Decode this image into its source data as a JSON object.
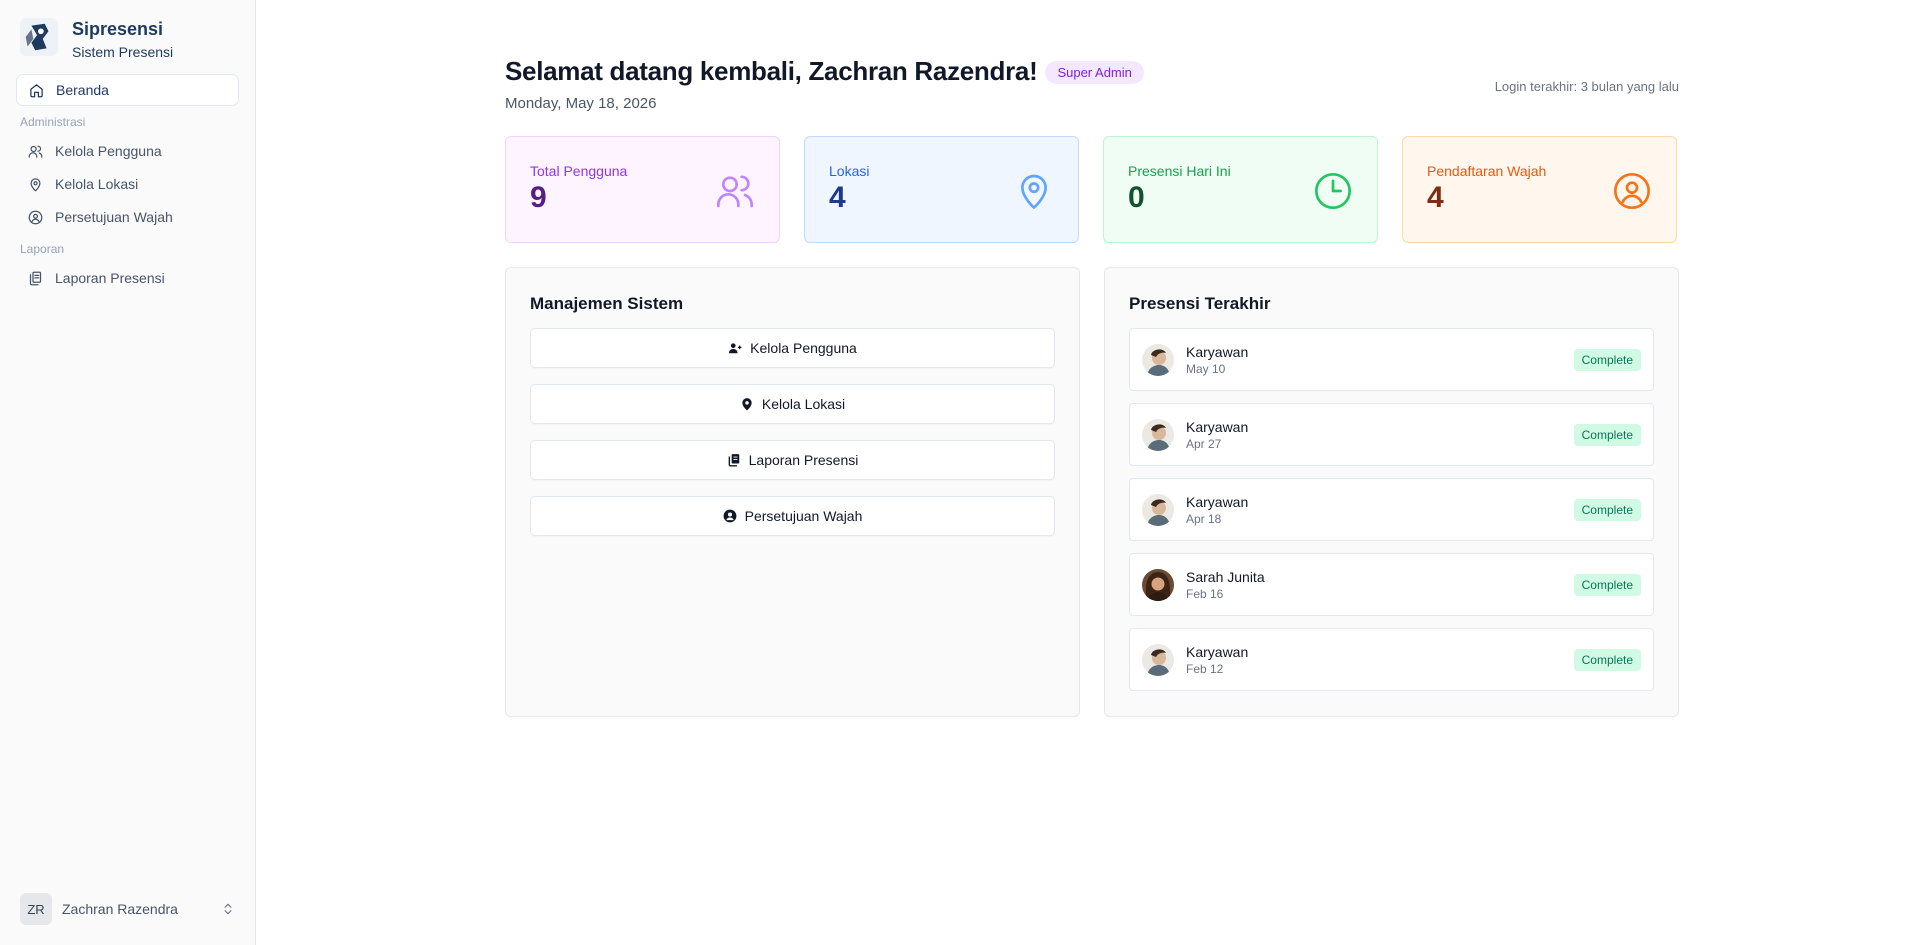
{
  "brand": {
    "title": "Sipresensi",
    "subtitle": "Sistem Presensi"
  },
  "sidebar": {
    "home": {
      "label": "Beranda",
      "icon": "home-icon"
    },
    "groups": [
      {
        "label": "Administrasi",
        "items": [
          {
            "label": "Kelola Pengguna",
            "icon": "users-icon"
          },
          {
            "label": "Kelola Lokasi",
            "icon": "map-pin-icon"
          },
          {
            "label": "Persetujuan Wajah",
            "icon": "user-circle-icon"
          }
        ]
      },
      {
        "label": "Laporan",
        "items": [
          {
            "label": "Laporan Presensi",
            "icon": "files-icon"
          }
        ]
      }
    ],
    "user": {
      "initials": "ZR",
      "name": "Zachran Razendra"
    }
  },
  "header": {
    "welcome": "Selamat datang kembali, Zachran Razendra!",
    "role_badge": "Super Admin",
    "date": "Monday, May 18, 2026",
    "last_login": "Login terakhir: 3 bulan yang lalu"
  },
  "stats": [
    {
      "label": "Total Pengguna",
      "value": "9",
      "icon": "users-icon",
      "color": "#c084fc"
    },
    {
      "label": "Lokasi",
      "value": "4",
      "icon": "map-pin-icon",
      "color": "#60a5fa"
    },
    {
      "label": "Presensi Hari Ini",
      "value": "0",
      "icon": "clock-icon",
      "color": "#22c55e"
    },
    {
      "label": "Pendaftaran Wajah",
      "value": "4",
      "icon": "user-circle-icon",
      "color": "#f97316"
    }
  ],
  "management": {
    "title": "Manajemen Sistem",
    "buttons": [
      {
        "label": "Kelola Pengguna",
        "icon": "users-solid-icon"
      },
      {
        "label": "Kelola Lokasi",
        "icon": "map-pin-solid-icon"
      },
      {
        "label": "Laporan Presensi",
        "icon": "files-solid-icon"
      },
      {
        "label": "Persetujuan Wajah",
        "icon": "user-circle-solid-icon"
      }
    ]
  },
  "recent_attendance": {
    "title": "Presensi Terakhir",
    "items": [
      {
        "name": "Karyawan",
        "date": "May 10",
        "status": "Complete"
      },
      {
        "name": "Karyawan",
        "date": "Apr 27",
        "status": "Complete"
      },
      {
        "name": "Karyawan",
        "date": "Apr 18",
        "status": "Complete"
      },
      {
        "name": "Sarah Junita",
        "date": "Feb 16",
        "status": "Complete"
      },
      {
        "name": "Karyawan",
        "date": "Feb 12",
        "status": "Complete"
      }
    ]
  }
}
